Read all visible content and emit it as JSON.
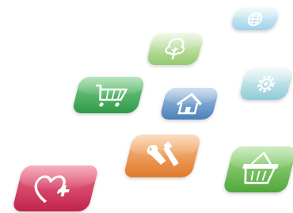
{
  "icons": [
    {
      "id": "globe",
      "color": "#9fd3ea"
    },
    {
      "id": "tree",
      "color": "#93c96c"
    },
    {
      "id": "gear",
      "color": "#8fcbd6"
    },
    {
      "id": "shopping-cart",
      "color": "#2e9a48"
    },
    {
      "id": "home",
      "color": "#4a7fb8"
    },
    {
      "id": "tools",
      "color": "#e07a2c"
    },
    {
      "id": "basket",
      "color": "#4fa73a"
    },
    {
      "id": "heart-plus",
      "color": "#c0234b"
    }
  ]
}
